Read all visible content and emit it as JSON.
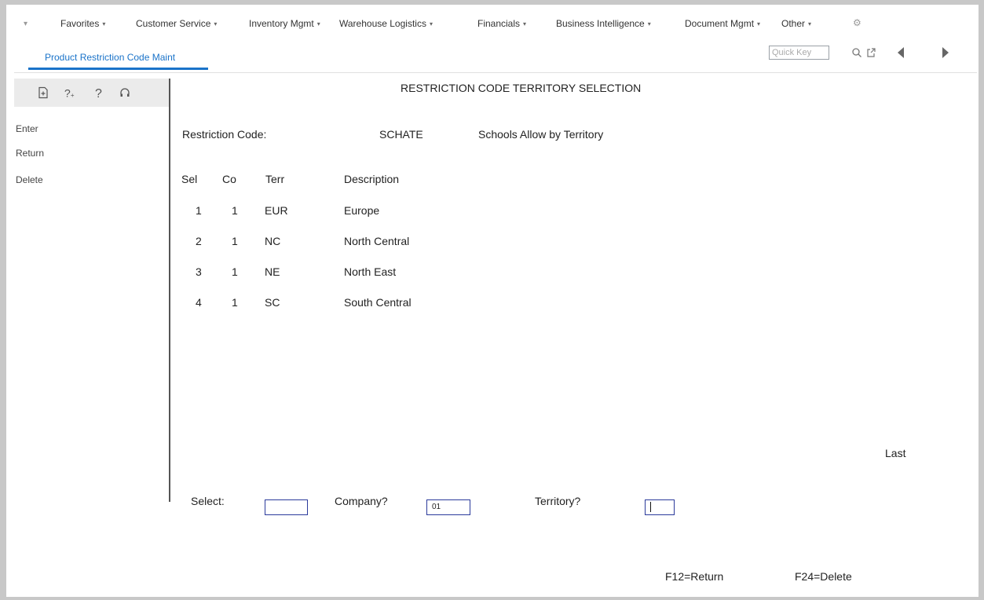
{
  "nav": {
    "favorites": "Favorites",
    "customer_service": "Customer Service",
    "inventory_mgmt": "Inventory Mgmt",
    "warehouse_logistics": "Warehouse Logistics",
    "financials": "Financials",
    "business_intelligence": "Business Intelligence",
    "document_mgmt": "Document Mgmt",
    "other": "Other",
    "caret": "▾",
    "collapse": "▾",
    "gear": "⚙"
  },
  "tab": {
    "label": "Product Restriction Code Maint"
  },
  "quick_key": {
    "placeholder": "Quick Key"
  },
  "sidebar": {
    "items": [
      "Enter",
      "Return",
      "Delete"
    ]
  },
  "screen": {
    "title": "RESTRICTION CODE TERRITORY SELECTION",
    "restriction_label": "Restriction Code:",
    "restriction_code": "SCHATE",
    "restriction_desc": "Schools Allow by Territory",
    "columns": {
      "sel": "Sel",
      "co": "Co",
      "terr": "Terr",
      "desc": "Description"
    },
    "rows": [
      {
        "sel": "1",
        "co": "1",
        "terr": "EUR",
        "desc": "Europe"
      },
      {
        "sel": "2",
        "co": "1",
        "terr": "NC",
        "desc": "North Central"
      },
      {
        "sel": "3",
        "co": "1",
        "terr": "NE",
        "desc": "North East"
      },
      {
        "sel": "4",
        "co": "1",
        "terr": "SC",
        "desc": "South Central"
      }
    ],
    "last_label": "Last",
    "select_label": "Select:",
    "select_value": "",
    "company_label": "Company?",
    "company_value": "01",
    "territory_label": "Territory?",
    "territory_value": "",
    "f12": "F12=Return",
    "f24": "F24=Delete"
  },
  "colors": {
    "accent": "#1a73c9",
    "input_border": "#2b3a9b",
    "background": "#c8c8c8"
  },
  "icons": [
    "collapse-caret-icon",
    "gear-icon",
    "search-icon",
    "external-link-icon",
    "arrow-left-icon",
    "arrow-right-icon",
    "new-document-icon",
    "help-plus-icon",
    "help-icon",
    "support-icon"
  ]
}
